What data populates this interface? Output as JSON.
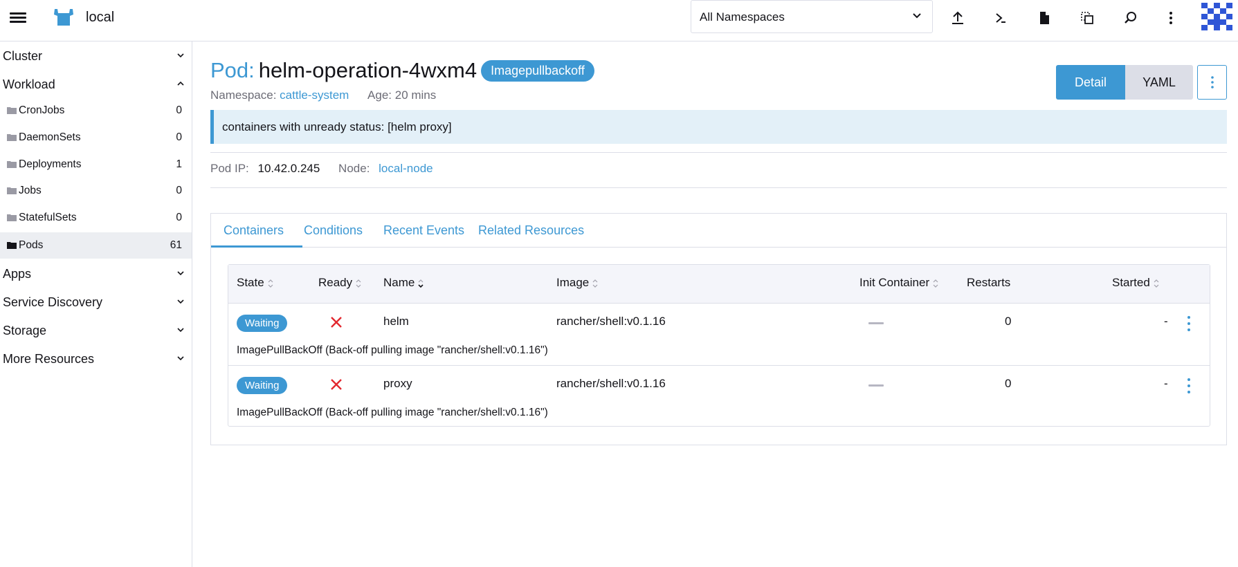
{
  "header": {
    "cluster_name": "local",
    "namespace_select": "All Namespaces",
    "icons": [
      "menu-icon",
      "upload-icon",
      "terminal-icon",
      "file-icon",
      "copy-icon",
      "search-icon",
      "more-vertical-icon"
    ]
  },
  "sidebar": {
    "groups": [
      {
        "label": "Cluster",
        "expanded": false
      },
      {
        "label": "Workload",
        "expanded": true
      },
      {
        "label": "Apps",
        "expanded": false
      },
      {
        "label": "Service Discovery",
        "expanded": false
      },
      {
        "label": "Storage",
        "expanded": false
      },
      {
        "label": "More Resources",
        "expanded": false
      }
    ],
    "workload_items": [
      {
        "label": "CronJobs",
        "count": "0"
      },
      {
        "label": "DaemonSets",
        "count": "0"
      },
      {
        "label": "Deployments",
        "count": "1"
      },
      {
        "label": "Jobs",
        "count": "0"
      },
      {
        "label": "StatefulSets",
        "count": "0"
      },
      {
        "label": "Pods",
        "count": "61",
        "active": true
      }
    ]
  },
  "page": {
    "kind": "Pod:",
    "name": "helm-operation-4wxm4",
    "state": "Imagepullbackoff",
    "namespace_label": "Namespace:",
    "namespace": "cattle-system",
    "age": "Age: 20 mins",
    "detail_button": "Detail",
    "yaml_button": "YAML",
    "banner": "containers with unready status: [helm proxy]",
    "pod_ip_label": "Pod IP:",
    "pod_ip": "10.42.0.245",
    "node_label": "Node:",
    "node": "local-node"
  },
  "tabs": [
    "Containers",
    "Conditions",
    "Recent Events",
    "Related Resources"
  ],
  "table": {
    "headers": [
      "State",
      "Ready",
      "Name",
      "Image",
      "Init Container",
      "Restarts",
      "Started"
    ],
    "rows": [
      {
        "state": "Waiting",
        "ready": "not-ready",
        "name": "helm",
        "image": "rancher/shell:v0.1.16",
        "restarts": "0",
        "started": "-",
        "message": "ImagePullBackOff (Back-off pulling image \"rancher/shell:v0.1.16\")"
      },
      {
        "state": "Waiting",
        "ready": "not-ready",
        "name": "proxy",
        "image": "rancher/shell:v0.1.16",
        "restarts": "0",
        "started": "-",
        "message": "ImagePullBackOff (Back-off pulling image \"rancher/shell:v0.1.16\")"
      }
    ]
  },
  "colors": {
    "accent": "#3d98d3",
    "error": "#e2282f",
    "border": "#dcdee7",
    "banner_bg": "#e3f0f8"
  }
}
